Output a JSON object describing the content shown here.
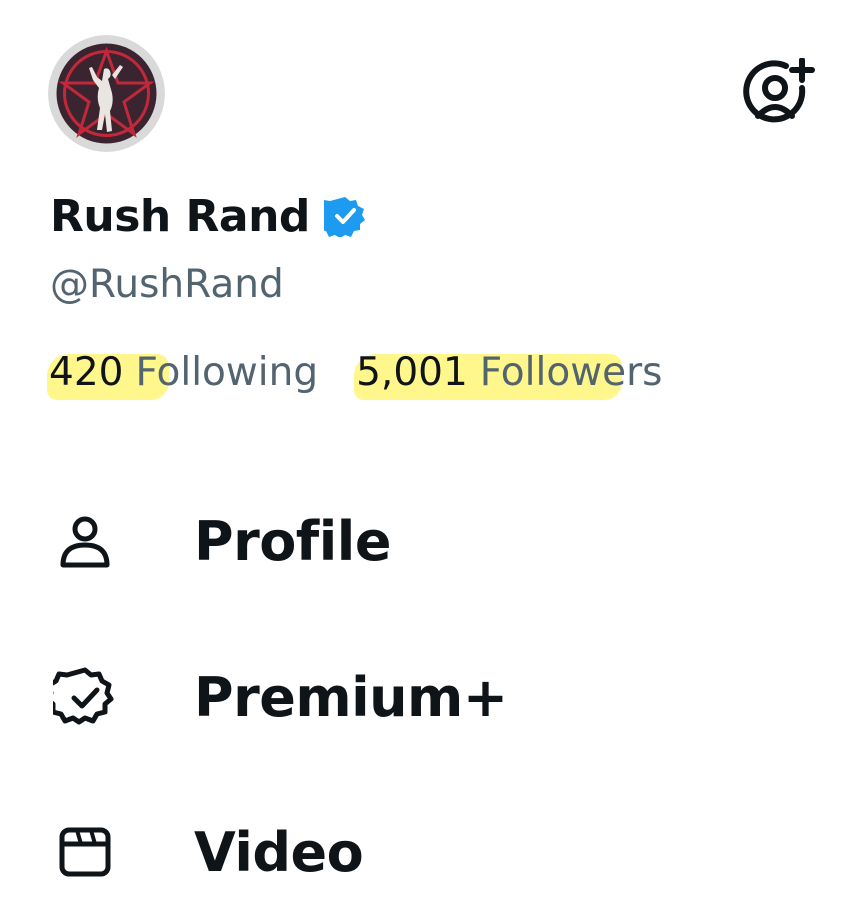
{
  "profile": {
    "display_name": "Rush Rand",
    "handle": "@RushRand",
    "verified_icon": "verified-badge-icon",
    "avatar_icon": "starman-avatar-icon",
    "add_account_icon": "add-account-icon"
  },
  "stats": {
    "following_count": "420",
    "following_label": "Following",
    "followers_count": "5,001",
    "followers_label": "Followers"
  },
  "menu": [
    {
      "label": "Profile",
      "icon": "person-icon"
    },
    {
      "label": "Premium+",
      "icon": "premium-badge-icon"
    },
    {
      "label": "Video",
      "icon": "video-icon"
    }
  ],
  "colors": {
    "text_primary": "#0f1419",
    "text_secondary": "#536471",
    "verified_blue": "#1d9bf0",
    "highlight": "#fff366"
  }
}
